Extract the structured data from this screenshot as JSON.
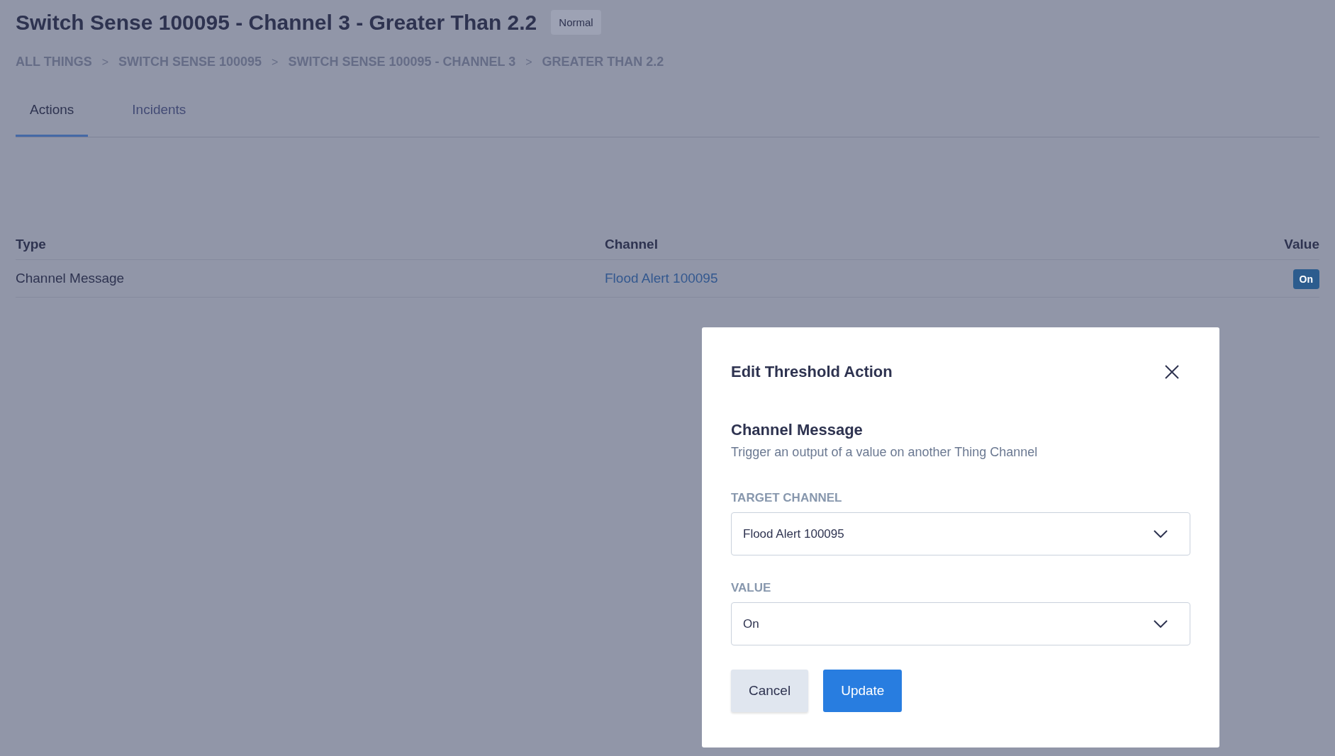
{
  "page": {
    "title": "Switch Sense 100095 - Channel 3 - Greater Than 2.2",
    "status_badge": "Normal"
  },
  "breadcrumbs": [
    {
      "label": "ALL THINGS",
      "separator": ">"
    },
    {
      "label": "SWITCH SENSE 100095",
      "separator": ">"
    },
    {
      "label": "SWITCH SENSE 100095 - CHANNEL 3",
      "separator": ">"
    },
    {
      "label": "GREATER THAN 2.2"
    }
  ],
  "tabs": [
    {
      "label": "Actions",
      "selected": true
    },
    {
      "label": "Incidents",
      "selected": false
    }
  ],
  "table": {
    "columns": [
      "Type",
      "Channel",
      "Value"
    ],
    "rows": [
      {
        "type": "Channel Message",
        "channel": "Flood Alert 100095",
        "value": "On"
      }
    ]
  },
  "modal": {
    "title": "Edit Threshold Action",
    "section_title": "Channel Message",
    "description": "Trigger an output of a value on another Thing Channel",
    "fields": [
      {
        "label": "TARGET CHANNEL",
        "value": "Flood Alert 100095"
      },
      {
        "label": "VALUE",
        "value": "On"
      }
    ],
    "buttons": [
      {
        "label": "Cancel",
        "kind": "secondary"
      },
      {
        "label": "Update",
        "kind": "primary"
      }
    ]
  }
}
